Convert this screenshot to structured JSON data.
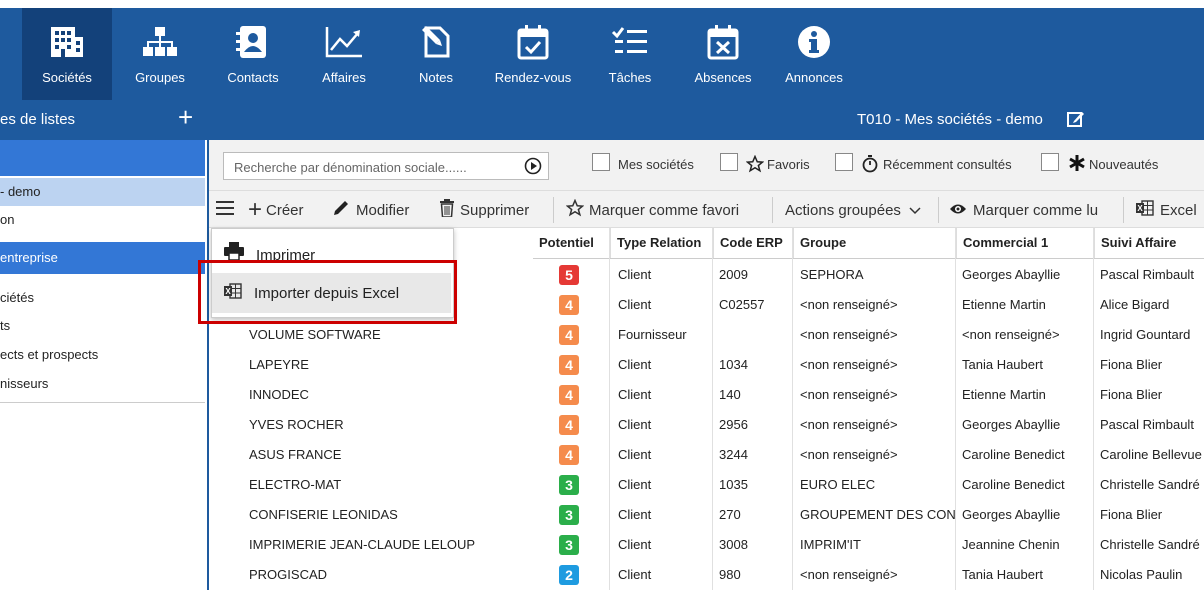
{
  "nav": {
    "items": [
      {
        "label": "Sociétés",
        "icon": "building-icon",
        "active": true
      },
      {
        "label": "Groupes",
        "icon": "org-chart-icon"
      },
      {
        "label": "Contacts",
        "icon": "contact-card-icon"
      },
      {
        "label": "Affaires",
        "icon": "chart-line-icon"
      },
      {
        "label": "Notes",
        "icon": "note-pen-icon"
      },
      {
        "label": "Rendez-vous",
        "icon": "calendar-check-icon"
      },
      {
        "label": "Tâches",
        "icon": "task-list-icon"
      },
      {
        "label": "Absences",
        "icon": "calendar-x-icon"
      },
      {
        "label": "Annonces",
        "icon": "info-icon"
      }
    ]
  },
  "sidebar": {
    "header": "es de listes",
    "items": [
      {
        "label": "- demo"
      },
      {
        "label": "on"
      },
      {
        "label": "entreprise"
      },
      {
        "label": "ciétés"
      },
      {
        "label": "ts"
      },
      {
        "label": "ects et prospects"
      },
      {
        "label": "nisseurs"
      }
    ]
  },
  "main": {
    "title": "T010 - Mes sociétés - demo"
  },
  "filters": {
    "search_placeholder": "Recherche par dénomination sociale......",
    "mes_societes": "Mes sociétés",
    "favoris": "Favoris",
    "recemment": "Récemment consultés",
    "nouveautes": "Nouveautés"
  },
  "toolbar": {
    "creer": "Créer",
    "modifier": "Modifier",
    "supprimer": "Supprimer",
    "favori": "Marquer comme favori",
    "actions": "Actions groupées",
    "marquer_lu": "Marquer comme lu",
    "excel": "Excel"
  },
  "dropdown": {
    "imprimer": "Imprimer",
    "importer": "Importer depuis Excel"
  },
  "table": {
    "headers": [
      "Potentiel",
      "Type Relation",
      "Code ERP",
      "Groupe",
      "Commercial 1",
      "Suivi Affaire"
    ],
    "rows": [
      {
        "name": "",
        "potentiel": "5",
        "color": "#e53935",
        "type": "Client",
        "erp": "2009",
        "groupe": "SEPHORA",
        "commercial": "Georges Abayllie",
        "suivi": "Pascal Rimbault"
      },
      {
        "name": "",
        "potentiel": "4",
        "color": "#f58b4c",
        "type": "Client",
        "erp": "C02557",
        "groupe": "<non renseigné>",
        "commercial": "Etienne Martin",
        "suivi": "Alice Bigard"
      },
      {
        "name": "VOLUME SOFTWARE",
        "potentiel": "4",
        "color": "#f58b4c",
        "type": "Fournisseur",
        "erp": "",
        "groupe": "<non renseigné>",
        "commercial": "<non renseigné>",
        "suivi": "Ingrid Gountard"
      },
      {
        "name": "LAPEYRE",
        "potentiel": "4",
        "color": "#f58b4c",
        "type": "Client",
        "erp": "1034",
        "groupe": "<non renseigné>",
        "commercial": "Tania Haubert",
        "suivi": "Fiona Blier"
      },
      {
        "name": "INNODEC",
        "potentiel": "4",
        "color": "#f58b4c",
        "type": "Client",
        "erp": "140",
        "groupe": "<non renseigné>",
        "commercial": "Etienne Martin",
        "suivi": "Fiona Blier"
      },
      {
        "name": "YVES ROCHER",
        "potentiel": "4",
        "color": "#f58b4c",
        "type": "Client",
        "erp": "2956",
        "groupe": "<non renseigné>",
        "commercial": "Georges Abayllie",
        "suivi": "Pascal Rimbault"
      },
      {
        "name": "ASUS FRANCE",
        "potentiel": "4",
        "color": "#f58b4c",
        "type": "Client",
        "erp": "3244",
        "groupe": "<non renseigné>",
        "commercial": "Caroline Benedict",
        "suivi": "Caroline Bellevue"
      },
      {
        "name": "ELECTRO-MAT",
        "potentiel": "3",
        "color": "#2bae4a",
        "type": "Client",
        "erp": "1035",
        "groupe": "EURO ELEC",
        "commercial": "Caroline Benedict",
        "suivi": "Christelle Sandré"
      },
      {
        "name": "CONFISERIE LEONIDAS",
        "potentiel": "3",
        "color": "#2bae4a",
        "type": "Client",
        "erp": "270",
        "groupe": "GROUPEMENT DES CON",
        "commercial": "Georges Abayllie",
        "suivi": "Fiona Blier"
      },
      {
        "name": "IMPRIMERIE JEAN-CLAUDE LELOUP",
        "potentiel": "3",
        "color": "#2bae4a",
        "type": "Client",
        "erp": "3008",
        "groupe": "IMPRIM'IT",
        "commercial": "Jeannine Chenin",
        "suivi": "Christelle Sandré"
      },
      {
        "name": "PROGISCAD",
        "potentiel": "2",
        "color": "#1e9be0",
        "type": "Client",
        "erp": "980",
        "groupe": "<non renseigné>",
        "commercial": "Tania Haubert",
        "suivi": "Nicolas Paulin"
      }
    ]
  }
}
